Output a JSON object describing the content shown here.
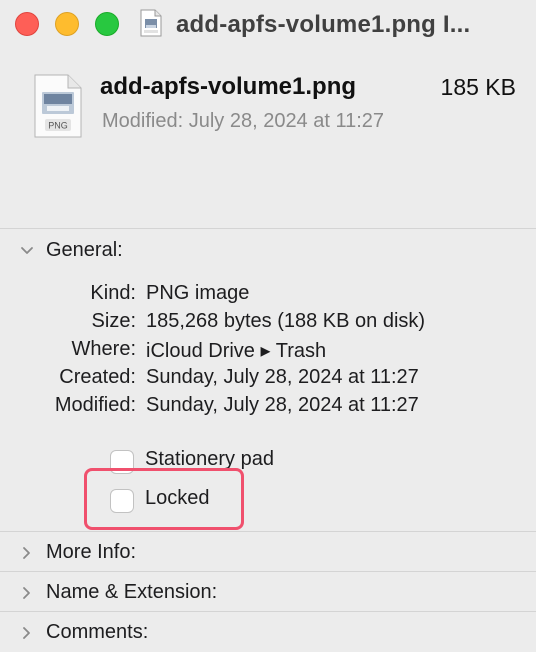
{
  "window": {
    "title": "add-apfs-volume1.png I..."
  },
  "file": {
    "name": "add-apfs-volume1.png",
    "size": "185 KB",
    "modified": "Modified: July 28, 2024 at 11:27",
    "icon_label": "PNG"
  },
  "general": {
    "label": "General:",
    "rows": [
      {
        "label": "Kind:",
        "value": "PNG image"
      },
      {
        "label": "Size:",
        "value": "185,268 bytes (188 KB on disk)"
      },
      {
        "label": "Where:",
        "value": "iCloud Drive ▸ Trash"
      },
      {
        "label": "Created:",
        "value": "Sunday, July 28, 2024 at 11:27"
      },
      {
        "label": "Modified:",
        "value": "Sunday, July 28, 2024 at 11:27"
      }
    ],
    "stationery_label": "Stationery pad",
    "locked_label": "Locked"
  },
  "sections": {
    "more_info": "More Info:",
    "name_extension": "Name & Extension:",
    "comments": "Comments:"
  },
  "colors": {
    "highlight": "#f0506d",
    "close": "#fe5f57",
    "minimize": "#febc2e",
    "maximize": "#28c840"
  },
  "icons": [
    "png-file-icon",
    "chevron-down-icon",
    "chevron-right-icon"
  ]
}
